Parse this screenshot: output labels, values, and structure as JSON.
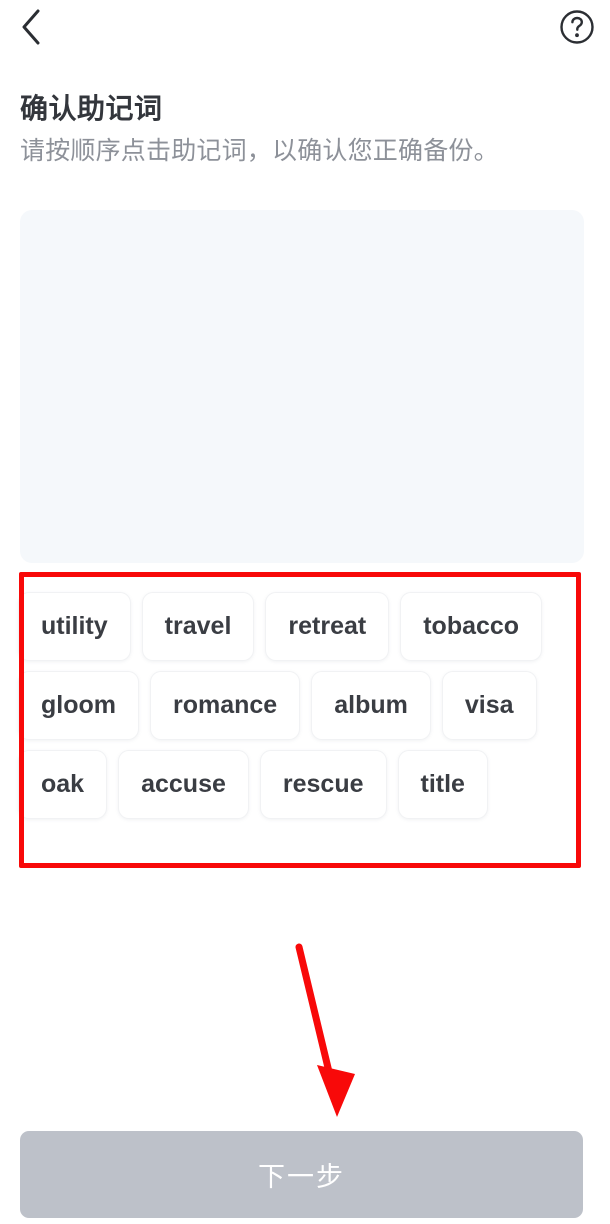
{
  "app": {
    "screen_name": "confirm-mnemonic",
    "background_color": "#ffffff"
  },
  "topbar": {
    "back_icon": "chevron-left-icon",
    "help_icon": "question-mark-circle-icon",
    "icon_color": "#2b2e33"
  },
  "heading": {
    "title": "确认助记词",
    "subtitle": "请按顺序点击助记词，以确认您正确备份。",
    "title_color": "#33363c",
    "subtitle_color": "#8d9199"
  },
  "answer_area": {
    "label": "selected-mnemonic-area",
    "selected_words": [],
    "background_color": "#f5f8fb",
    "empty": true
  },
  "word_bank": {
    "label": "mnemonic-word-bank",
    "rows": [
      [
        "utility",
        "travel",
        "retreat",
        "tobacco"
      ],
      [
        "gloom",
        "romance",
        "album",
        "visa"
      ],
      [
        "oak",
        "accuse",
        "rescue",
        "title"
      ]
    ],
    "words": [
      "utility",
      "travel",
      "retreat",
      "tobacco",
      "gloom",
      "romance",
      "album",
      "visa",
      "oak",
      "accuse",
      "rescue",
      "title"
    ],
    "word_count": 12,
    "chip_background": "#ffffff",
    "chip_text_color": "#3a3d43"
  },
  "annotations": {
    "highlight_box": {
      "name": "word-bank-highlight",
      "color": "#f80909",
      "target": "mnemonic-word-bank"
    },
    "arrow": {
      "name": "pointer-arrow-to-next-button",
      "color": "#f80909",
      "target": "next-button"
    }
  },
  "footer": {
    "next_label": "下一步",
    "next_enabled": false,
    "next_background": "#bdc1c9",
    "next_text_color": "#ffffff"
  }
}
